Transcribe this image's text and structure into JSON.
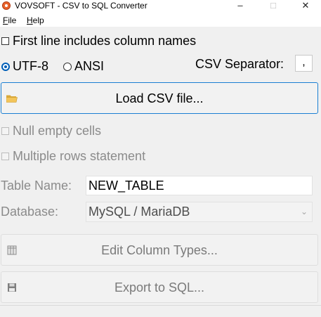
{
  "window": {
    "title": "VOVSOFT - CSV to SQL Converter",
    "minimize_glyph": "–",
    "maximize_glyph": "□",
    "close_glyph": "✕"
  },
  "menu": {
    "file_mnemonic": "F",
    "file_rest": "ile",
    "help_mnemonic": "H",
    "help_rest": "elp"
  },
  "options": {
    "first_line_label": "First line includes column names",
    "first_line_checked": false,
    "encoding_utf8_label": "UTF-8",
    "encoding_ansi_label": "ANSI",
    "encoding_selected": "UTF-8",
    "csv_separator_label": "CSV Separator:",
    "csv_separator_value": ","
  },
  "buttons": {
    "load_csv_label": "Load CSV file...",
    "edit_column_types_label": "Edit Column Types...",
    "export_sql_label": "Export to SQL..."
  },
  "settings": {
    "null_empty_cells_label": "Null empty cells",
    "multiple_rows_label": "Multiple rows statement",
    "table_name_label": "Table Name:",
    "table_name_value": "NEW_TABLE",
    "database_label": "Database:",
    "database_value": "MySQL / MariaDB"
  },
  "icons": {
    "app": "vovsoft-app-icon",
    "load": "folder-open-icon",
    "edit": "columns-icon",
    "export": "floppy-disk-icon",
    "dropdown": "chevron-down-icon"
  },
  "colors": {
    "accent": "#005fb8",
    "focus_border": "#1a7fd3",
    "disabled_text": "#8b8b8b",
    "window_bg": "#f0f0f0"
  }
}
